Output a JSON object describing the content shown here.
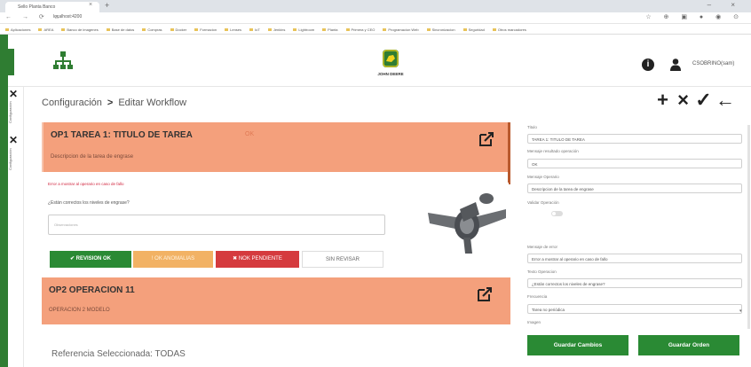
{
  "browser": {
    "tab_title": "Sello Planta Banco",
    "url": "localhost:4200",
    "bookmarks": [
      "Aplicaciones",
      "AREA",
      "Banco de imagenes",
      "Base de datos",
      "Compras",
      "Docker",
      "Formacion",
      "Lenses",
      "IoT",
      "Jenkins",
      "Lightroom",
      "Planta",
      "Primera y CEO",
      "Programacion Web",
      "Sincronizacion",
      "Seguridad",
      "Otros marcadores"
    ]
  },
  "header": {
    "brand": "JOHN DEERE",
    "username": "CSOBRINO(sam)"
  },
  "sidebar": {
    "label_1": "Configuración",
    "label_2": "Configuración"
  },
  "breadcrumb": {
    "parent": "Configuración",
    "separator": ">",
    "current": "Editar Workflow"
  },
  "actions": {
    "add": "+",
    "cancel": "×",
    "confirm": "✓",
    "back": "←"
  },
  "op1": {
    "title": "OP1 TAREA 1: TITULO DE TAREA",
    "status": "OK",
    "description": "Descripcion de la tarea de engrase",
    "error_message": "Error a mostrar al operario en caso de fallo",
    "question": "¿Están correctos los niveles de engrase?",
    "answer_placeholder": "Observaciones",
    "buttons": {
      "ok": "✔ REVISION OK",
      "anomalies": "! OK ANOMALIAS",
      "nok": "✖ NOK PENDIENTE",
      "unreviewed": "SIN REVISAR"
    }
  },
  "op2": {
    "title": "OP2 OPERACION 11",
    "description": "OPERACION 2 MODELO"
  },
  "reference": "Referencia Seleccionada: TODAS",
  "panel": {
    "titulo_label": "Titulo",
    "titulo_value": "TAREA 1: TITULO DE TAREA",
    "msg_resultado_label": "Mensaje resultado operación",
    "msg_resultado_value": "OK",
    "msg_operario_label": "Mensaje Operario",
    "msg_operario_value": "Descripcion de la tarea de engrase",
    "validar_label": "Validar Operación",
    "msg_error_label": "Mensaje de error",
    "msg_error_value": "Error a mostrar al operario en caso de fallo",
    "texto_operacion_label": "Texto Operacion",
    "texto_operacion_value": "¿Están correctos los niveles de engrase?",
    "frecuencia_label": "Frecuencia",
    "frecuencia_value": "Tarea no periódica",
    "imagen_label": "Imagen",
    "save_changes": "Guardar Cambios",
    "save_order": "Guardar Orden"
  },
  "colors": {
    "green": "#2a8a34",
    "salmon": "#f4a07c",
    "red": "#d53b3e",
    "amber": "#f2b264"
  }
}
